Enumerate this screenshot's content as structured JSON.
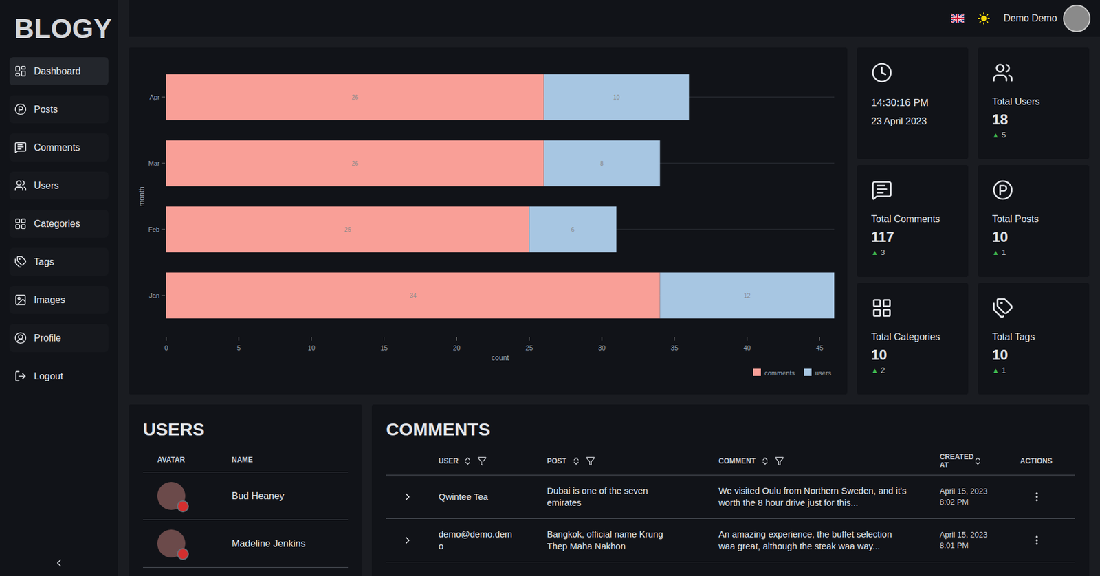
{
  "app": {
    "logo": "BLOGY"
  },
  "sidebar": {
    "items": [
      {
        "label": "Dashboard",
        "selected": true,
        "kind": "link"
      },
      {
        "label": "Posts",
        "selected": false,
        "kind": "link"
      },
      {
        "label": "Comments",
        "selected": false,
        "kind": "link"
      },
      {
        "label": "Users",
        "selected": false,
        "kind": "link"
      },
      {
        "label": "Categories",
        "selected": false,
        "kind": "link"
      },
      {
        "label": "Tags",
        "selected": false,
        "kind": "link"
      },
      {
        "label": "Images",
        "selected": false,
        "kind": "link"
      },
      {
        "label": "Profile",
        "selected": false,
        "kind": "link"
      },
      {
        "label": "Logout",
        "selected": false,
        "kind": "action"
      }
    ]
  },
  "header": {
    "user": "Demo Demo"
  },
  "chart": {
    "y_axis_title": "month",
    "x_axis_title": "count",
    "categories": [
      "Jan",
      "Feb",
      "Mar",
      "Apr"
    ],
    "x_ticks": [
      "0",
      "5",
      "10",
      "15",
      "20",
      "25",
      "30",
      "35",
      "40",
      "45"
    ],
    "series": [
      {
        "name": "comments",
        "color": "#f99f97",
        "values": [
          34,
          25,
          26,
          26
        ]
      },
      {
        "name": "users",
        "color": "#a7c6e2",
        "values": [
          12,
          6,
          8,
          10
        ]
      }
    ]
  },
  "stats": [
    {
      "kind": "clock",
      "time": "14:30:16 PM",
      "date": "23 April 2023"
    },
    {
      "kind": "metric",
      "label": "Total Users",
      "value": "18",
      "arrow": "▲",
      "delta": "5"
    },
    {
      "kind": "metric",
      "label": "Total Comments",
      "value": "117",
      "arrow": "▲",
      "delta": "3"
    },
    {
      "kind": "metric",
      "label": "Total Posts",
      "value": "10",
      "arrow": "▲",
      "delta": "1"
    },
    {
      "kind": "metric",
      "label": "Total Categories",
      "value": "10",
      "arrow": "▲",
      "delta": "2"
    },
    {
      "kind": "metric",
      "label": "Total Tags",
      "value": "10",
      "arrow": "▲",
      "delta": "1"
    }
  ],
  "users_table": {
    "title": "USERS",
    "columns": [
      "AVATAR",
      "NAME"
    ],
    "rows": [
      {
        "name": "Bud Heaney",
        "online": false
      },
      {
        "name": "Madeline Jenkins",
        "online": false
      }
    ]
  },
  "comments_table": {
    "title": "COMMENTS",
    "columns": [
      {
        "label": "USER",
        "sortable": true,
        "filterable": true
      },
      {
        "label": "POST",
        "sortable": true,
        "filterable": true
      },
      {
        "label": "COMMENT",
        "sortable": true,
        "filterable": true
      },
      {
        "label": "CREATED AT",
        "sortable": true,
        "filterable": false
      },
      {
        "label": "ACTIONS",
        "sortable": false,
        "filterable": false
      }
    ],
    "rows": [
      {
        "expanded": false,
        "user": "Qwintee Tea",
        "post": "Dubai is one of the seven emirates",
        "comment": "We visited Oulu from Northern Sweden, and it's worth the 8 hour drive just for this...",
        "created_date": "April 15, 2023",
        "created_time": "8:02 PM"
      },
      {
        "expanded": false,
        "user": "demo@demo.demo",
        "post": "Bangkok, official name Krung Thep Maha Nakhon",
        "comment": "An amazing experience, the buffet selection waa great, although the steak waa way...",
        "created_date": "April 15, 2023",
        "created_time": "8:01 PM"
      }
    ]
  }
}
